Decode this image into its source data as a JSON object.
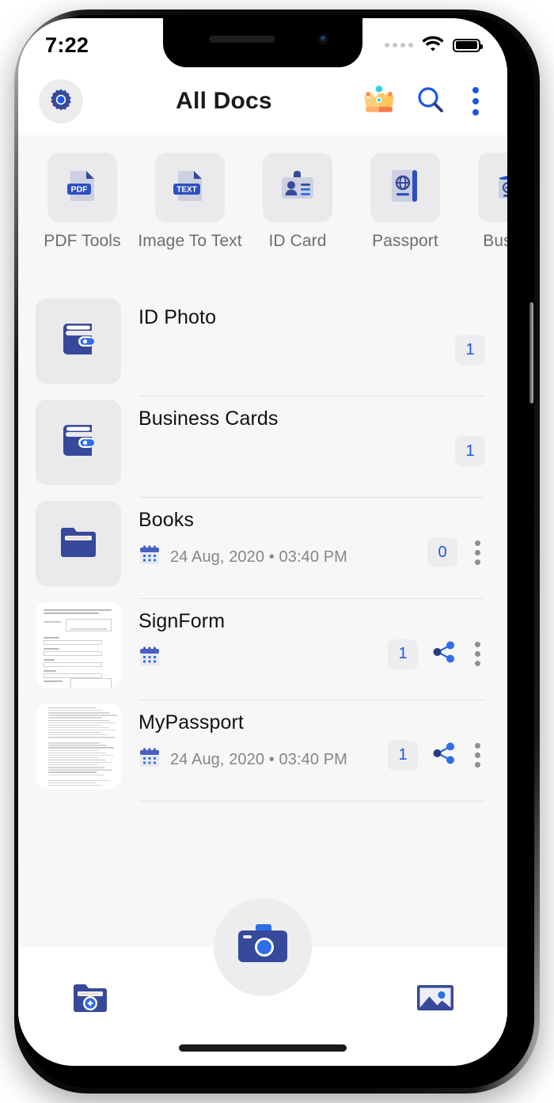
{
  "status_bar": {
    "time": "7:22",
    "signal_icon": "signal-dots-icon",
    "wifi_icon": "wifi-icon",
    "battery_icon": "battery-full-icon"
  },
  "app_bar": {
    "title": "All Docs",
    "settings_icon": "gear-icon",
    "premium_icon": "crown-icon",
    "search_icon": "search-icon",
    "overflow_icon": "kebab-menu-icon"
  },
  "categories": [
    {
      "label": "PDF Tools",
      "icon": "pdf-file-icon",
      "badge": "PDF"
    },
    {
      "label": "Image To Text",
      "icon": "text-file-icon",
      "badge": "TEXT"
    },
    {
      "label": "ID Card",
      "icon": "id-card-icon",
      "badge": ""
    },
    {
      "label": "Passport",
      "icon": "passport-icon",
      "badge": ""
    },
    {
      "label": "Busines",
      "icon": "business-card-icon",
      "badge": ""
    }
  ],
  "documents": [
    {
      "title": "ID Photo",
      "date": "",
      "count": "1",
      "thumb_icon": "wallet-icon",
      "thumb_type": "icon",
      "has_share": false,
      "has_overflow": false,
      "has_calendar": false
    },
    {
      "title": "Business Cards",
      "date": "",
      "count": "1",
      "thumb_icon": "wallet-icon",
      "thumb_type": "icon",
      "has_share": false,
      "has_overflow": false,
      "has_calendar": false
    },
    {
      "title": "Books",
      "date": "24 Aug, 2020  •  03:40 PM",
      "count": "0",
      "thumb_icon": "folder-icon",
      "thumb_type": "icon",
      "has_share": false,
      "has_overflow": true,
      "has_calendar": true
    },
    {
      "title": "SignForm",
      "date": "",
      "count": "1",
      "thumb_icon": "form-document-thumbnail",
      "thumb_type": "form",
      "has_share": true,
      "has_overflow": true,
      "has_calendar": true
    },
    {
      "title": "MyPassport",
      "date": "24 Aug, 2020  •  03:40 PM",
      "count": "1",
      "thumb_icon": "text-document-thumbnail",
      "thumb_type": "dense",
      "has_share": true,
      "has_overflow": true,
      "has_calendar": true
    }
  ],
  "bottom_bar": {
    "new_folder_icon": "folder-add-icon",
    "camera_icon": "camera-icon",
    "gallery_icon": "gallery-image-icon"
  },
  "colors": {
    "primary_blue": "#1a56e8",
    "navy": "#36499a",
    "chip_text": "#1a56e8",
    "page_bg": "#f7f7f8",
    "tile_bg": "#eaeaec",
    "muted_text": "#86868b",
    "label_text": "#6d6d72",
    "crown_gold": "#ffc65c",
    "crown_orange": "#fb8c4a"
  }
}
